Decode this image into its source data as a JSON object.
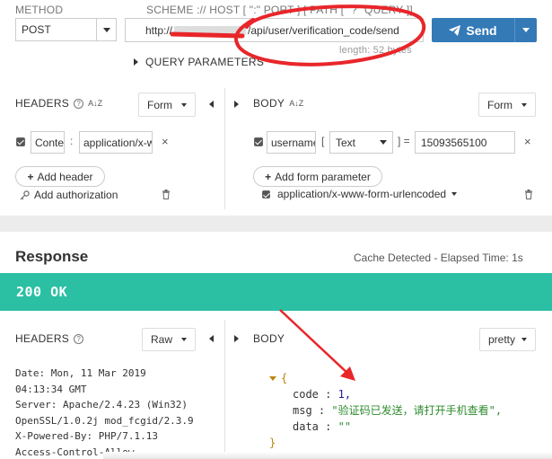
{
  "request": {
    "method_label": "METHOD",
    "method_value": "POST",
    "url_label": "SCHEME :// HOST [ \":\" PORT ] [ PATH [ \"?\" QUERY ]]",
    "url_prefix": "http://",
    "url_path": "/api/user/verification_code/send",
    "length_text": "length: 52 bytes",
    "send_label": "Send",
    "query_params_label": "QUERY PARAMETERS"
  },
  "req_headers": {
    "title": "HEADERS",
    "sort_icon": "A↓Z",
    "mode_label": "Form",
    "row": {
      "name": "Content-Type",
      "value": "application/x-www-form-urlencoded"
    },
    "add_header_label": "Add header",
    "add_auth_label": "Add authorization"
  },
  "req_body": {
    "title": "BODY",
    "sort_icon": "A↓Z",
    "mode_label": "Form",
    "row": {
      "name": "username",
      "type": "Text",
      "value": "15093565100"
    },
    "add_param_label": "Add form parameter",
    "content_type": "application/x-www-form-urlencoded"
  },
  "response": {
    "title": "Response",
    "cache_info": "Cache Detected - Elapsed Time: 1s",
    "status": "200 OK",
    "headers_title": "HEADERS",
    "headers_mode": "Raw",
    "body_title": "BODY",
    "body_mode": "pretty",
    "raw_headers": [
      "Date: Mon, 11 Mar 2019",
      "04:13:34 GMT",
      "Server: Apache/2.4.23 (Win32)",
      "OpenSSL/1.0.2j mod_fcgid/2.3.9",
      "X-Powered-By: PHP/7.1.13",
      "Access-Control-Allow-..."
    ],
    "json": {
      "open": "{",
      "close": "}",
      "code_key": "code",
      "code_val": "1,",
      "msg_key": "msg",
      "msg_val": "\"验证码已发送，请打开手机查看\",",
      "data_key": "data",
      "data_val": "\"\""
    }
  },
  "colors": {
    "send_blue": "#337ab7",
    "status_teal": "#2bbfa3",
    "annotation_red": "#e8262a",
    "json_string": "#2e8b2e",
    "json_number": "#1a1aa6"
  }
}
